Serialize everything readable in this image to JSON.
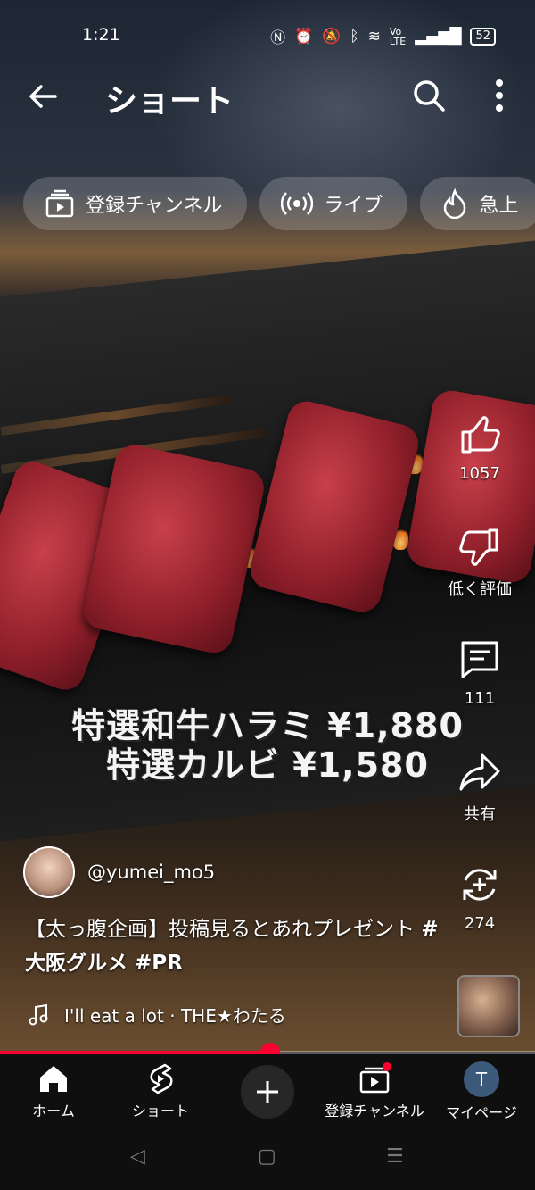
{
  "status_bar": {
    "time": "1:21",
    "battery": "52"
  },
  "header": {
    "title": "ショート"
  },
  "chips": [
    {
      "label": "登録チャンネル",
      "icon": "subscriptions-icon"
    },
    {
      "label": "ライブ",
      "icon": "live-icon"
    },
    {
      "label": "急上",
      "icon": "trending-icon"
    }
  ],
  "video": {
    "overlay_line1": "特選和牛ハラミ ¥1,880",
    "overlay_line2": "特選カルビ ¥1,580"
  },
  "actions": {
    "like_count": "1057",
    "dislike_label": "低く評価",
    "comment_count": "111",
    "share_label": "共有",
    "remix_count": "274"
  },
  "channel": {
    "handle": "@yumei_mo5"
  },
  "caption": {
    "text": "【太っ腹企画】投稿見るとあれプレゼント",
    "tags": "#大阪グルメ #PR"
  },
  "music": {
    "title": "I'll eat a lot · THE★わたる"
  },
  "progress": {
    "fraction": 0.505
  },
  "bottom_nav": {
    "home": "ホーム",
    "shorts": "ショート",
    "subscriptions": "登録チャンネル",
    "mypage": "マイページ",
    "avatar_letter": "T"
  },
  "colors": {
    "accent": "#ff0033",
    "nav_bg": "#0f0f0f"
  }
}
